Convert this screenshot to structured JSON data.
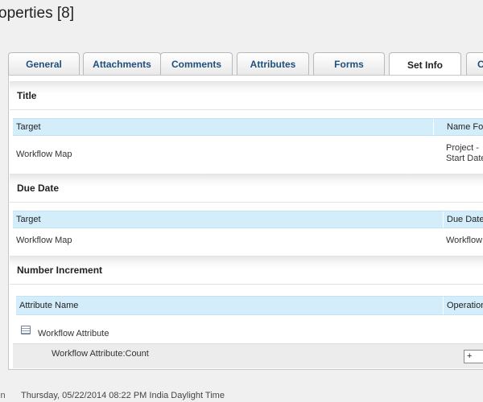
{
  "page": {
    "title": "operties [8]"
  },
  "tabs": [
    {
      "label": "General"
    },
    {
      "label": "Attachments"
    },
    {
      "label": "Comments"
    },
    {
      "label": "Attributes"
    },
    {
      "label": "Forms"
    },
    {
      "label": "Set Info",
      "active": true
    },
    {
      "label": "C"
    }
  ],
  "sections": {
    "title": {
      "heading": "Title",
      "columns": [
        "Target",
        "Name For"
      ],
      "row": {
        "target": "Workflow Map",
        "value_line1": "Project -",
        "value_line2": "Start Date"
      }
    },
    "due_date": {
      "heading": "Due Date",
      "columns": [
        "Target",
        "Due Date"
      ],
      "row": {
        "target": "Workflow Map",
        "value": "Workflow"
      }
    },
    "number_increment": {
      "heading": "Number Increment",
      "columns": [
        "Attribute Name",
        "Operation"
      ],
      "group_label": "Workflow Attribute",
      "item_label": "Workflow Attribute:Count",
      "operation_value": "+"
    }
  },
  "footer": {
    "left_text": "in",
    "timestamp": "Thursday, 05/22/2014 08:22 PM India Daylight Time"
  },
  "icons": {
    "attribute": "attribute-icon",
    "dropdown": "chevron-down-icon"
  },
  "colors": {
    "tab_text": "#1f4f7c",
    "column_header_bg": "#d3edfb",
    "page_bg": "#f0f0f0"
  }
}
